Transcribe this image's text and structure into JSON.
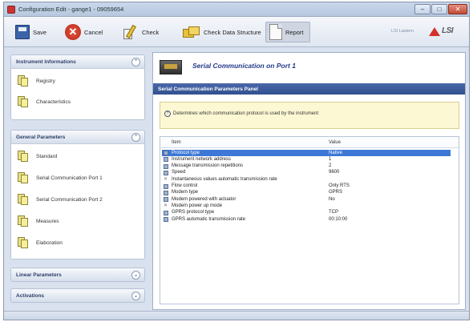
{
  "window": {
    "title": "Configuration Edit - gange1 - 09059654"
  },
  "toolbar": {
    "save": "Save",
    "cancel": "Cancel",
    "check": "Check",
    "check_data_structure": "Check Data Structure",
    "report": "Report",
    "brand_small": "LSI Lastem",
    "logo_text": "LSI"
  },
  "sidebar": {
    "groups": [
      {
        "title": "Instrument Informations",
        "items": [
          "Registry",
          "Characteristics"
        ]
      },
      {
        "title": "General Parameters",
        "items": [
          "Standard",
          "Serial Communication Port 1",
          "Serial Communication Port 2",
          "Measures",
          "Elaboration"
        ]
      },
      {
        "title": "Linear Parameters",
        "items": []
      },
      {
        "title": "Activations",
        "items": []
      }
    ]
  },
  "main": {
    "title": "Serial Communication on Port 1",
    "panel_title": "Serial Communication Parameters Panel",
    "description": "Determines which communication protocol is used by the instrument",
    "columns": {
      "item": "Item",
      "value": "Value"
    },
    "rows": [
      {
        "item": "Protocol type",
        "value": "Native",
        "selected": true
      },
      {
        "item": "Instrument network address",
        "value": "1"
      },
      {
        "item": "Message transmission repetitions",
        "value": "2"
      },
      {
        "item": "Speed",
        "value": "9600"
      },
      {
        "item": "Instantaneous values automatic transmission rate",
        "value": ""
      },
      {
        "item": "Flow control",
        "value": "Only RTS"
      },
      {
        "item": "Modem type",
        "value": "GPRS"
      },
      {
        "item": "Modem powered with actuator",
        "value": "No"
      },
      {
        "item": "Modem power up mode",
        "value": ""
      },
      {
        "item": "GPRS protocol type",
        "value": "TCP"
      },
      {
        "item": "GPRS automatic transmission rate",
        "value": "00:10:00"
      }
    ]
  }
}
